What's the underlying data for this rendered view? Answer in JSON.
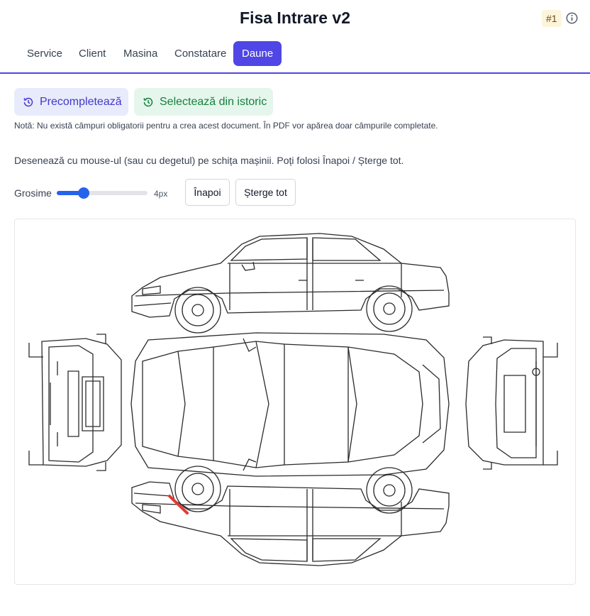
{
  "header": {
    "title": "Fisa Intrare v2",
    "badge": "#1"
  },
  "tabs": [
    {
      "label": "Service",
      "active": false
    },
    {
      "label": "Client",
      "active": false
    },
    {
      "label": "Masina",
      "active": false
    },
    {
      "label": "Constatare",
      "active": false
    },
    {
      "label": "Daune",
      "active": true
    }
  ],
  "actions": {
    "prefill_label": "Precompletează",
    "history_label": "Selectează din istoric"
  },
  "note": "Notă: Nu există câmpuri obligatorii pentru a crea acest document. În PDF vor apărea doar câmpurile completate.",
  "instructions": "Desenează cu mouse-ul (sau cu degetul) pe schița mașinii. Poți folosi Înapoi / Șterge tot.",
  "brush": {
    "label": "Grosime",
    "value_label": "4px",
    "level": 0.3
  },
  "buttons": {
    "undo_label": "Înapoi",
    "clear_label": "Șterge tot"
  },
  "colors": {
    "accent": "#4f46e5",
    "slider": "#2563eb",
    "damage_stroke": "#e53935"
  }
}
